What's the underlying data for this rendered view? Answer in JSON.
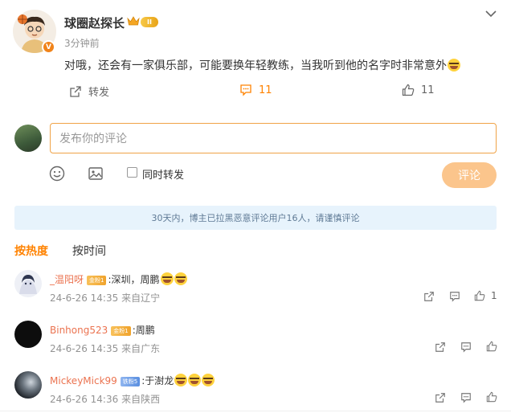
{
  "post": {
    "author": "球圈赵探长",
    "level_badge": "II",
    "time": "3分钟前",
    "text": "对哦，还会有一家俱乐部，可能要换年轻教练，当我听到他的名字时非常意外",
    "actions": {
      "repost_label": "转发",
      "comment_count": "11",
      "like_count": "11"
    }
  },
  "composer": {
    "placeholder": "发布你的评论",
    "also_repost_label": "同时转发",
    "submit_label": "评论"
  },
  "notice": "30天内，博主已拉黑恶意评论用户16人，请谨慎评论",
  "sort_tabs": [
    "按热度",
    "按时间"
  ],
  "comments": [
    {
      "name": "_温阳呀",
      "badge": "金粉1",
      "text": ":深圳，周鹏",
      "emoji_count": 2,
      "date": "24-6-26 14:35",
      "location": "来自辽宁",
      "like_count": "1"
    },
    {
      "name": "Binhong523",
      "badge": "金粉1",
      "text": ":周鹏",
      "emoji_count": 0,
      "date": "24-6-26 14:35",
      "location": "来自广东",
      "like_count": ""
    },
    {
      "name": "MickeyMick99",
      "badge": "铁粉5",
      "text": ":于澍龙",
      "emoji_count": 3,
      "date": "24-6-26 14:36",
      "location": "来自陕西",
      "like_count": ""
    }
  ],
  "colors": {
    "accent": "#ff8200",
    "username": "#eb7350",
    "notice_bg": "#e7f3fc",
    "submit_bg": "#fbc58c"
  },
  "icons": {
    "more": "chevron-down-icon",
    "repost": "share-icon",
    "comment": "comment-icon",
    "like": "thumbs-up-icon",
    "emoji": "emoji-icon",
    "image": "image-icon"
  }
}
